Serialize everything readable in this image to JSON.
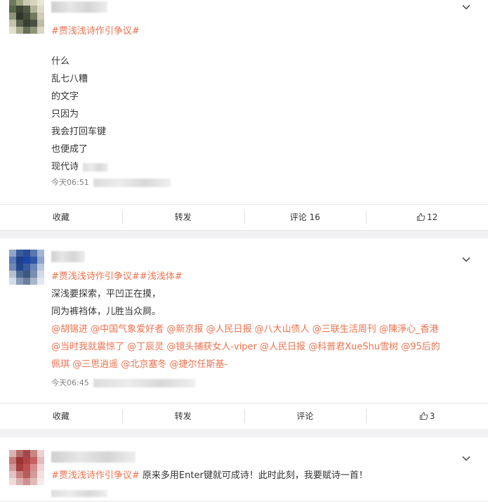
{
  "posts": [
    {
      "topics": [
        "#贾浅浅诗作引争议#"
      ],
      "lines": [
        "什么",
        "乱七八糟",
        "的文字",
        "只因为",
        "我会打回车键",
        "也便成了",
        "现代诗"
      ],
      "time": "今天06:51",
      "actions": {
        "collect": "收藏",
        "repost": "转发",
        "comment": "评论 16",
        "like": "12"
      }
    },
    {
      "topics": [
        "#贾浅浅诗作引争议#",
        "#浅浅体#"
      ],
      "lines": [
        "深浅要探索，平凹正在摸，",
        "同为裤裆体，儿胜当众屙。"
      ],
      "mentions_line1": [
        "@胡锡进",
        "@中国气象爱好者",
        "@新京报",
        "@人民日报",
        "@八大山债人",
        "@三联生活周刊",
        "@陳淨心_香港"
      ],
      "mentions_line2": [
        "@当时我就震惊了",
        "@丁辰灵",
        "@镜头捕获女人-viper",
        "@人民日报",
        "@科普君XueShu雪树",
        "@95后的"
      ],
      "mentions_line3_pre": "佩琪",
      "mentions_line3": [
        "@三思逍遥",
        "@北京塞冬",
        "@捷尔任斯基-"
      ],
      "time": "今天06:45",
      "actions": {
        "collect": "收藏",
        "repost": "转发",
        "comment": "评论",
        "like": "3"
      }
    },
    {
      "topics": [
        "#贾浅浅诗作引争议#"
      ],
      "text": " 原来多用Enter键就可成诗！此时此刻，我要赋诗一首！"
    }
  ],
  "icons": {
    "more": "chevron-down-icon",
    "like": "thumbs-up-icon"
  },
  "colors": {
    "link": "#eb7350",
    "text": "#333333",
    "meta": "#808080",
    "background": "#f2f2f5"
  }
}
